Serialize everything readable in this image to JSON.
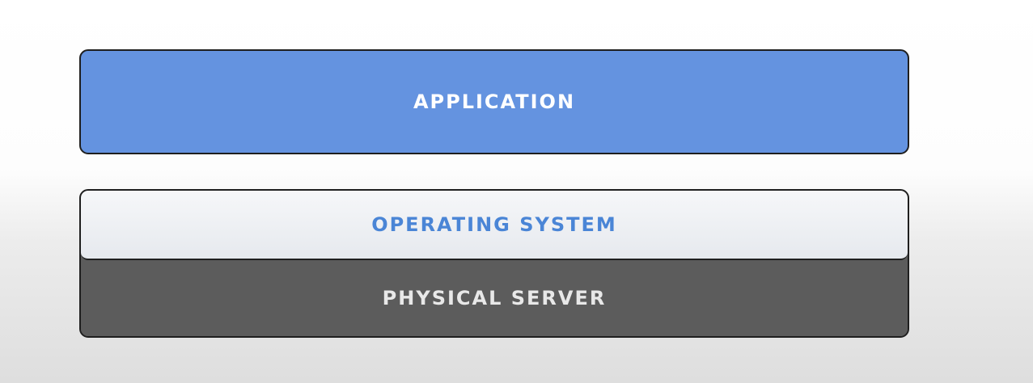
{
  "layers": {
    "application": "APPLICATION",
    "operating_system": "OPERATING SYSTEM",
    "physical_server": "PHYSICAL SERVER"
  },
  "colors": {
    "application_fill": "#6493e0",
    "application_text": "#ffffff",
    "os_fill": "#eef0f3",
    "os_text": "#4a85d6",
    "server_fill": "#5c5c5c",
    "server_text": "#e8e8e8",
    "outline": "#1f1f1f"
  }
}
